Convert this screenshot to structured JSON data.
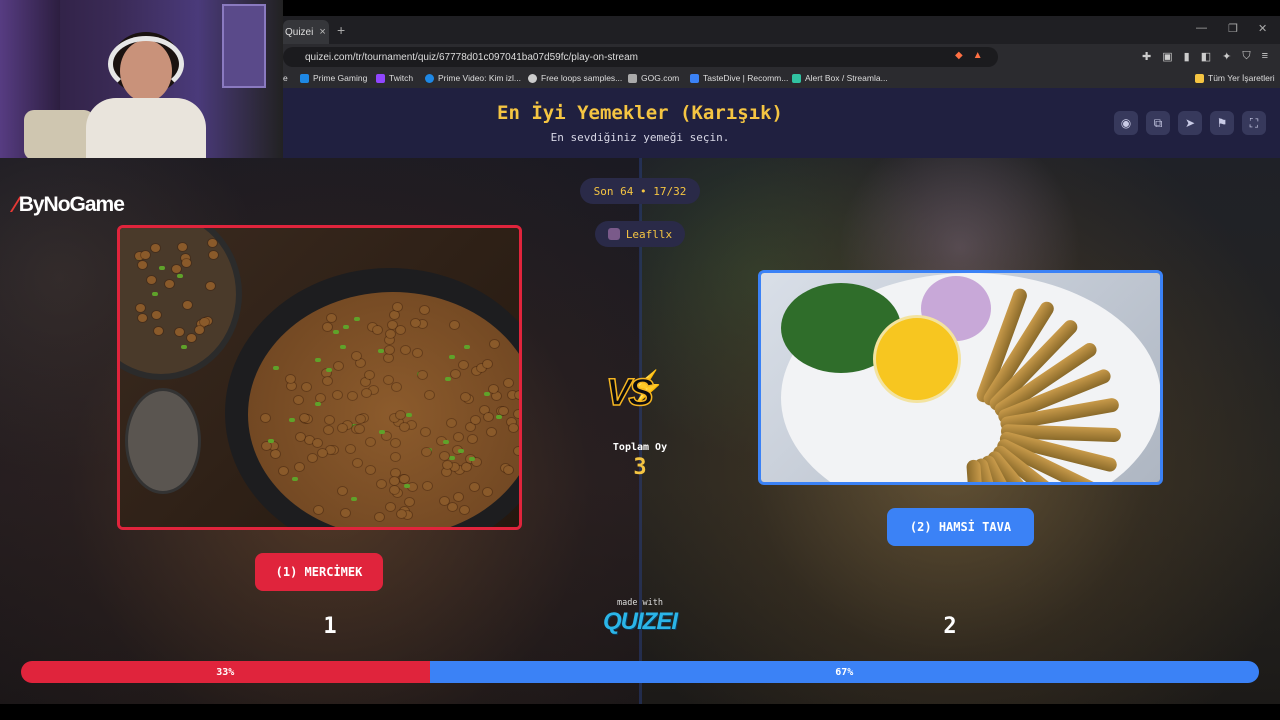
{
  "browser": {
    "tab_title": "Quizei",
    "tab_close": "×",
    "new_tab": "+",
    "window_controls": [
      "—",
      "❐",
      "✕"
    ],
    "url_prefix": "Quizei",
    "url": "quizei.com/tr/tournament/quiz/67778d01c097041ba07d59fc/play-on-stream",
    "bookmarks": [
      {
        "label": "e",
        "icon": "bookmark-icon",
        "color": "#888888"
      },
      {
        "label": "Prime Gaming",
        "icon": "prime-gaming-icon",
        "color": "#1e88e5"
      },
      {
        "label": "Twitch",
        "icon": "twitch-icon",
        "color": "#9146ff"
      },
      {
        "label": "Prime Video: Kim izl...",
        "icon": "prime-video-icon",
        "color": "#1e88e5"
      },
      {
        "label": "Free loops samples...",
        "icon": "loops-icon",
        "color": "#cccccc"
      },
      {
        "label": "GOG.com",
        "icon": "gog-icon",
        "color": "#aaaaaa"
      },
      {
        "label": "TasteDive | Recomm...",
        "icon": "tastedive-icon",
        "color": "#3b82f6"
      },
      {
        "label": "Alert Box / Streamla...",
        "icon": "streamlabs-icon",
        "color": "#31c3a2"
      },
      {
        "label": "Tüm Yer İşaretleri",
        "icon": "folder-icon",
        "color": "#f5c542"
      }
    ]
  },
  "header": {
    "title": "En İyi Yemekler (Karışık)",
    "subtitle": "En sevdiğiniz yemeği seçin.",
    "icons": [
      "eye-icon",
      "share-icon",
      "send-icon",
      "flag-icon",
      "fullscreen-icon"
    ]
  },
  "stage": {
    "brand_overlay": "ByNoGame",
    "round": "Son 64 • 17/32",
    "user": "Leafllx",
    "vs": "VS",
    "total_label": "Toplam Oy",
    "total_value": "3",
    "left": {
      "label": "(1) MERCİMEK",
      "votes": "1",
      "percent_label": "33%",
      "percent": 33,
      "color": "#e0243c"
    },
    "right": {
      "label": "(2) HAMSİ TAVA",
      "votes": "2",
      "percent_label": "67%",
      "percent": 67,
      "color": "#3b82f6"
    },
    "made_with": "made with",
    "brand": "QUIZEI"
  }
}
